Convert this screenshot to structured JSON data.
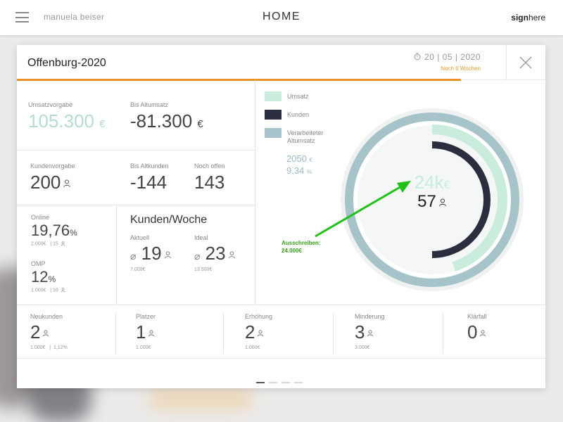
{
  "topbar": {
    "username": "manuela beiser",
    "title": "HOME",
    "logo_prefix": "sign",
    "logo_suffix": "here"
  },
  "modal": {
    "title": "Offenburg-2020",
    "date": "20 | 05 | 2020",
    "weeks_left": "Noch 6 Wochen",
    "progress_fraction": 0.84
  },
  "stats": {
    "umsatzvorgabe": {
      "label": "Umsatzvorgabe",
      "value": "105.300",
      "unit": "€"
    },
    "bis_altumsatz": {
      "label": "Bis Altumsatz",
      "value": "-81.300",
      "unit": "€"
    },
    "kundenvorgabe": {
      "label": "Kundenvorgabe",
      "value": "200"
    },
    "bis_altkunden": {
      "label": "Bis Altkunden",
      "value": "-144"
    },
    "noch_offen": {
      "label": "Noch offen",
      "value": "143"
    },
    "online": {
      "label": "Online",
      "value": "19,76",
      "unit": "%",
      "sub1": "2.000€",
      "sub2": "15"
    },
    "omp": {
      "label": "OMP",
      "value": "12",
      "unit": "%",
      "sub1": "1.000€",
      "sub2": "10"
    },
    "kunden_woche": {
      "label": "Kunden/Woche",
      "aktuell": {
        "label": "Aktuell",
        "prefix": "⌀",
        "value": "19",
        "sub": "7.000€"
      },
      "ideal": {
        "label": "Ideal",
        "prefix": "⌀",
        "value": "23",
        "sub": "13.500€"
      }
    }
  },
  "legend": {
    "items": [
      {
        "label": "Umsatz",
        "color": "#c9ecdd"
      },
      {
        "label": "Kunden",
        "color": "#2b2e3e"
      },
      {
        "label": "Verarbeiteter Altumsatz",
        "color": "#a7c3ca"
      }
    ],
    "value1": "2050",
    "value1_unit": "€",
    "value2": "9,34",
    "value2_unit": "%"
  },
  "donut": {
    "center_value": "24k",
    "center_unit": "€",
    "center_count": "57",
    "ring_outer_fraction": 1.0,
    "ring_middle_fraction": 0.45,
    "ring_inner_fraction": 0.5
  },
  "annotation": {
    "line1": "Ausschreiben:",
    "line2": "24.000€",
    "color": "#22c01a"
  },
  "bottom": [
    {
      "label": "Neukunden",
      "value": "2",
      "sub1": "1.000€",
      "sub2": "1,12%"
    },
    {
      "label": "Platzer",
      "value": "1",
      "sub1": "1.000€",
      "sub2": ""
    },
    {
      "label": "Erhöhung",
      "value": "2",
      "sub1": "1.000€",
      "sub2": ""
    },
    {
      "label": "Minderung",
      "value": "3",
      "sub1": "3.000€",
      "sub2": ""
    },
    {
      "label": "Klärfall",
      "value": "0",
      "sub1": "",
      "sub2": ""
    }
  ],
  "pagination": {
    "count": 4,
    "active": 0
  },
  "colors": {
    "accent": "#e8912b",
    "teal_light": "#c9ecdd",
    "navy": "#2b2e3e",
    "grey_blue": "#a7c3ca"
  }
}
